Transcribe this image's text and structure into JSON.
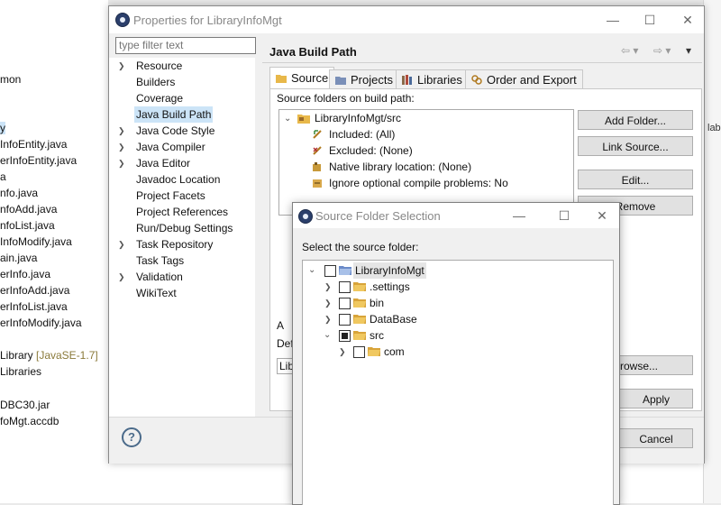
{
  "background": {
    "explorer_lines": [
      "mon",
      "y",
      "InfoEntity.java",
      "erInfoEntity.java",
      "a",
      "nfo.java",
      "nfoAdd.java",
      "nfoList.java",
      "InfoModify.java",
      "ain.java",
      "erInfo.java",
      "erInfoAdd.java",
      "erInfoList.java",
      "erInfoModify.java",
      "Library",
      "[JavaSE-1.7]",
      "Libraries",
      "DBC30.jar",
      "foMgt.accdb"
    ],
    "right_fragments": [
      "lab"
    ]
  },
  "properties_window": {
    "title": "Properties for LibraryInfoMgt",
    "filter_placeholder": "type filter text",
    "nav_items": [
      "Resource",
      "Builders",
      "Coverage",
      "Java Build Path",
      "Java Code Style",
      "Java Compiler",
      "Java Editor",
      "Javadoc Location",
      "Project Facets",
      "Project References",
      "Run/Debug Settings",
      "Task Repository",
      "Task Tags",
      "Validation",
      "WikiText"
    ],
    "selected_nav": "Java Build Path",
    "page_title": "Java Build Path",
    "tabs": [
      "Source",
      "Projects",
      "Libraries",
      "Order and Export"
    ],
    "active_tab": "Source",
    "source_label": "Source folders on build path:",
    "source_tree": {
      "root": "LibraryInfoMgt/src",
      "children": [
        "Included: (All)",
        "Excluded: (None)",
        "Native library location: (None)",
        "Ignore optional compile problems: No"
      ]
    },
    "buttons": {
      "add_folder": "Add Folder...",
      "link_source": "Link Source...",
      "edit": "Edit...",
      "remove": "Remove",
      "browse": "Browse...",
      "apply": "Apply",
      "cancel": "Cancel"
    },
    "fragments": {
      "allow_left": "A",
      "default_left": "Def",
      "lib_left": "Lib"
    },
    "help_icon": "?"
  },
  "source_folder_dialog": {
    "title": "Source Folder Selection",
    "label": "Select the source folder:",
    "tree": {
      "root": "LibraryInfoMgt",
      "items": [
        ".settings",
        "bin",
        "DataBase",
        "src"
      ],
      "src_children": [
        "com"
      ]
    }
  },
  "colors": {
    "selection": "#cce4f7",
    "folder": "#e8b84a",
    "window_bg": "#f0f0f0"
  }
}
